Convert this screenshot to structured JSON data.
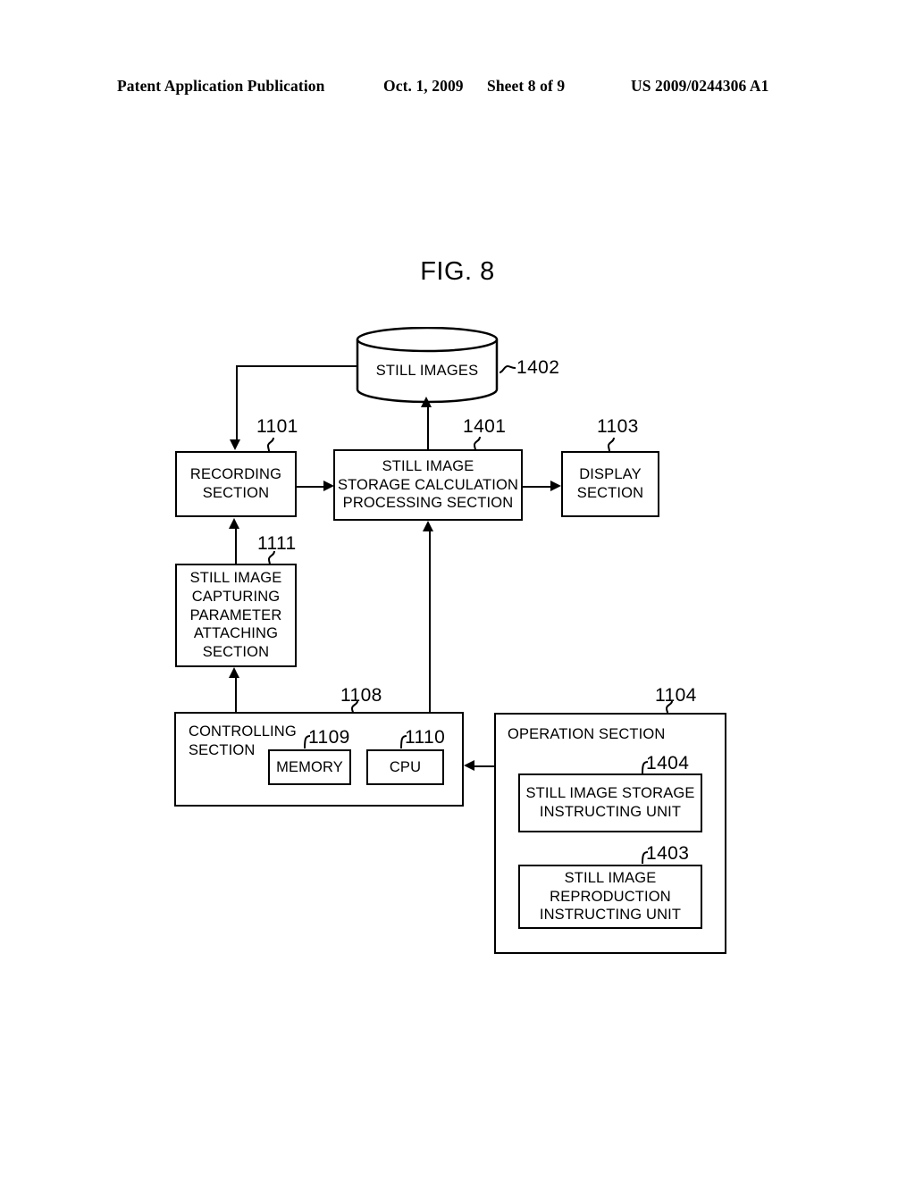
{
  "header": {
    "publication": "Patent Application Publication",
    "date": "Oct. 1, 2009",
    "sheet": "Sheet 8 of 9",
    "patent_number": "US 2009/0244306 A1"
  },
  "figure": {
    "title": "FIG. 8"
  },
  "nodes": {
    "still_images_store": {
      "label": "STILL IMAGES",
      "ref": "1402"
    },
    "recording_section": {
      "label": "RECORDING\nSECTION",
      "ref": "1101"
    },
    "storage_calculation": {
      "label": "STILL IMAGE\nSTORAGE CALCULATION\nPROCESSING SECTION",
      "ref": "1401"
    },
    "display_section": {
      "label": "DISPLAY\nSECTION",
      "ref": "1103"
    },
    "parameter_attaching": {
      "label": "STILL IMAGE\nCAPTURING\nPARAMETER\nATTACHING\nSECTION",
      "ref": "1111"
    },
    "controlling_section": {
      "label": "CONTROLLING\nSECTION",
      "ref": "1108"
    },
    "memory": {
      "label": "MEMORY",
      "ref": "1109"
    },
    "cpu": {
      "label": "CPU",
      "ref": "1110"
    },
    "operation_section": {
      "label": "OPERATION SECTION",
      "ref": "1104"
    },
    "storage_instructing_unit": {
      "label": "STILL IMAGE STORAGE\nINSTRUCTING UNIT",
      "ref": "1404"
    },
    "reproduction_instructing_unit": {
      "label": "STILL IMAGE\nREPRODUCTION\nINSTRUCTING UNIT",
      "ref": "1403"
    }
  }
}
